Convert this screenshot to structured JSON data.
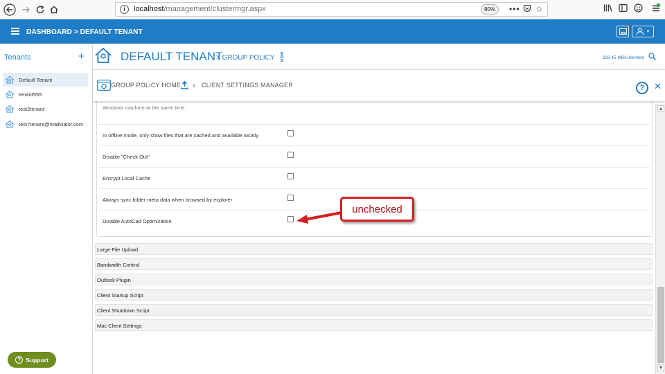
{
  "browser": {
    "url_host": "localhost",
    "url_path": "/management/clustermgr.aspx",
    "zoom": "80%",
    "more_label": "•••"
  },
  "header": {
    "title": "DASHBOARD > DEFAULT TENANT"
  },
  "sidebar": {
    "title": "Tenants",
    "add_label": "+",
    "tenants": [
      {
        "label": "Default Tenant",
        "active": true
      },
      {
        "label": "tenant555",
        "active": false
      },
      {
        "label": "test2tenant",
        "active": false
      },
      {
        "label": "test7tenant@mailinator.com",
        "active": false
      }
    ],
    "support_label": "Support"
  },
  "title_bar": {
    "tenant_name": "DEFAULT TENANT",
    "crumb": "> GROUP POLICY",
    "storage": "332.45 MB/Unlimited"
  },
  "sub_header": {
    "home_label": "GROUP POLICY HOME",
    "current_label": "CLIENT SETTINGS MANAGER",
    "help_label": "?",
    "close_label": "✕"
  },
  "settings": {
    "partial_text": "Windows machine at the same time.",
    "rows": [
      {
        "label": "In offline mode, only show files that are cached and available locally",
        "checked": false
      },
      {
        "label": "Disable \"Check Out\"",
        "checked": false
      },
      {
        "label": "Encrypt Local Cache",
        "checked": false
      },
      {
        "label": "Always sync folder meta data when browsed by explorer",
        "checked": false
      },
      {
        "label": "Disable AutoCad Optimization",
        "checked": false
      }
    ]
  },
  "sections": [
    "Large File Upload",
    "Bandwidth Control",
    "Outlook Plugin",
    "Client Startup Script",
    "Client Shutdown Script",
    "Mac Client Settings"
  ],
  "annotation": {
    "text": "unchecked"
  },
  "colors": {
    "brand_blue": "#1f7cc6",
    "support_green": "#6e8e1f",
    "annotation_red": "#d41f1f"
  }
}
